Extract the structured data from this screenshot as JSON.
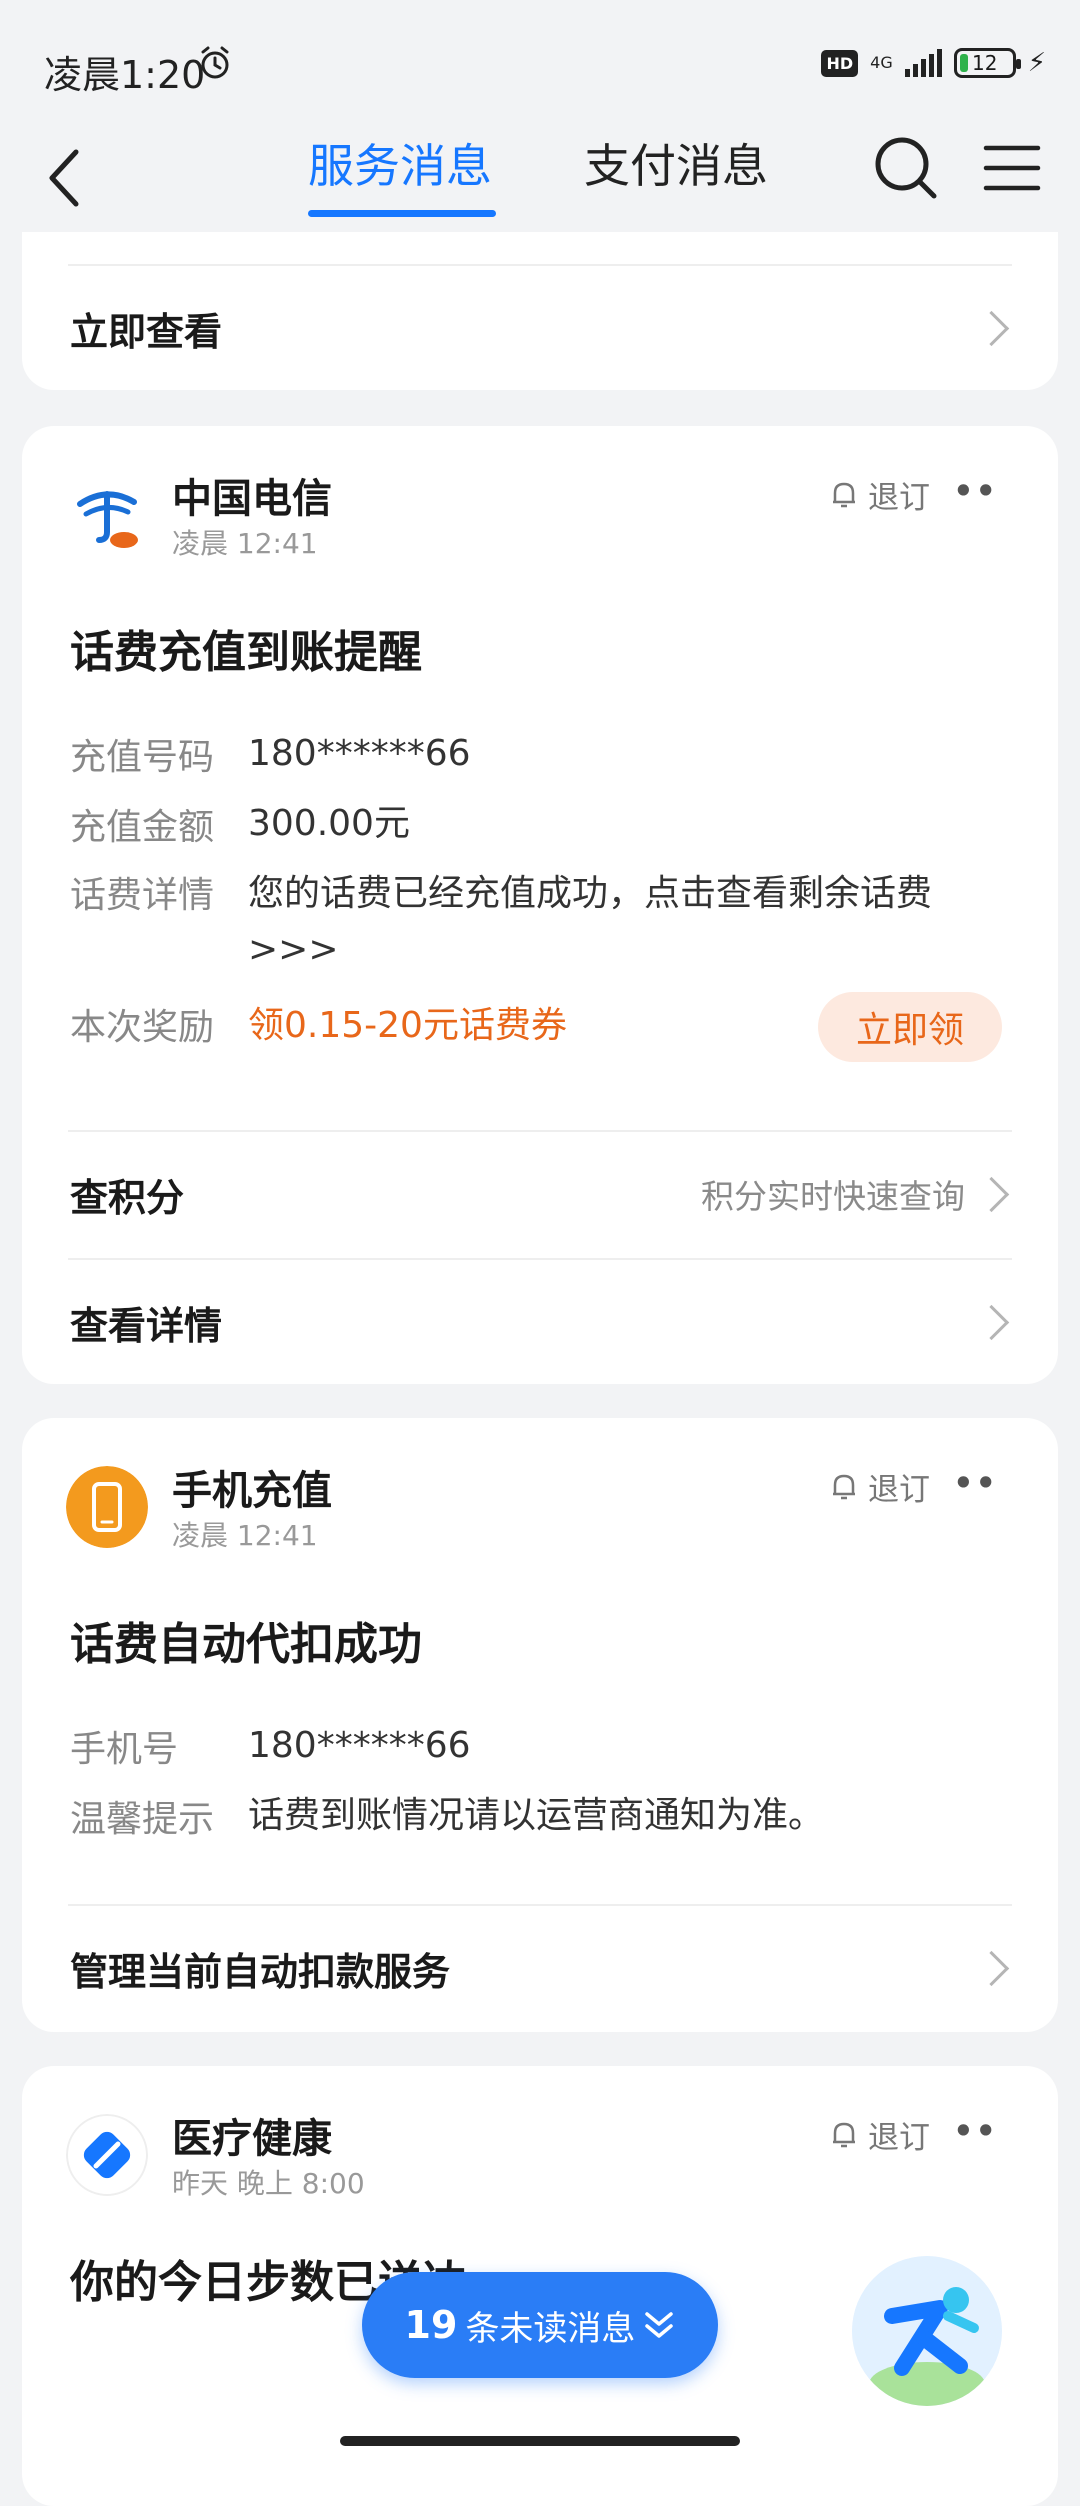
{
  "status_bar": {
    "time": "凌晨1:20",
    "hd": "HD",
    "network": "4G",
    "battery": "12"
  },
  "nav": {
    "tabs": [
      {
        "label": "服务消息",
        "active": true
      },
      {
        "label": "支付消息",
        "active": false
      }
    ]
  },
  "top_card": {
    "link_label": "立即查看"
  },
  "telecom_card": {
    "sender": "中国电信",
    "time": "凌晨 12:41",
    "unsubscribe": "退订",
    "more": "••",
    "title": "话费充值到账提醒",
    "fields": [
      {
        "key": "充值号码",
        "value": "180******66"
      },
      {
        "key": "充值金额",
        "value": "300.00元"
      },
      {
        "key": "话费详情",
        "value": "您的话费已经充值成功，点击查看剩余话费>>>"
      },
      {
        "key": "本次奖励",
        "value": "领0.15-20元话费券"
      }
    ],
    "claim_label": "立即领",
    "links": [
      {
        "label": "查积分",
        "hint": "积分实时快速查询"
      },
      {
        "label": "查看详情",
        "hint": ""
      }
    ]
  },
  "recharge_card": {
    "sender": "手机充值",
    "time": "凌晨 12:41",
    "unsubscribe": "退订",
    "more": "••",
    "title": "话费自动代扣成功",
    "fields": [
      {
        "key": "手机号",
        "value": "180******66"
      },
      {
        "key": "温馨提示",
        "value": "话费到账情况请以运营商通知为准。"
      }
    ],
    "link_label": "管理当前自动扣款服务"
  },
  "health_card": {
    "sender": "医疗健康",
    "time": "昨天 晚上 8:00",
    "unsubscribe": "退订",
    "more": "••",
    "title": "你的今日步数已送达"
  },
  "unread_pill": {
    "count": "19",
    "label": "条未读消息"
  },
  "colors": {
    "accent": "#1677ff",
    "reward": "#e8671a",
    "background": "#f2f3f5"
  }
}
